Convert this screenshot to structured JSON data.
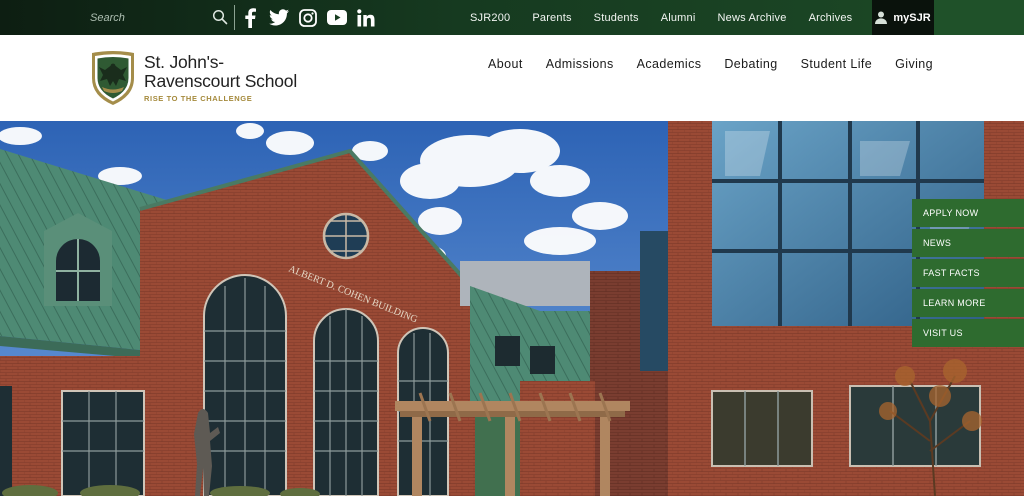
{
  "topbar": {
    "search_placeholder": "Search",
    "social": [
      "facebook-icon",
      "twitter-icon",
      "instagram-icon",
      "youtube-icon",
      "linkedin-icon"
    ],
    "links": [
      "SJR200",
      "Parents",
      "Students",
      "Alumni",
      "News Archive",
      "Archives"
    ],
    "mysjr_label": "mySJR"
  },
  "header": {
    "school_name_line1": "St. John's-",
    "school_name_line2": "Ravenscourt School",
    "tagline": "RISE TO THE CHALLENGE",
    "nav": [
      "About",
      "Admissions",
      "Academics",
      "Debating",
      "Student Life",
      "Giving"
    ]
  },
  "hero": {
    "building_sign": "ALBERT D. COHEN BUILDING"
  },
  "quick_links": [
    "APPLY NOW",
    "NEWS",
    "FAST FACTS",
    "LEARN MORE",
    "VISIT US"
  ],
  "colors": {
    "topbar_dark": "#0d1e12",
    "topbar_green": "#1d4a26",
    "quick_link_green": "#2e6b2f",
    "tagline_gold": "#a58a3c"
  }
}
